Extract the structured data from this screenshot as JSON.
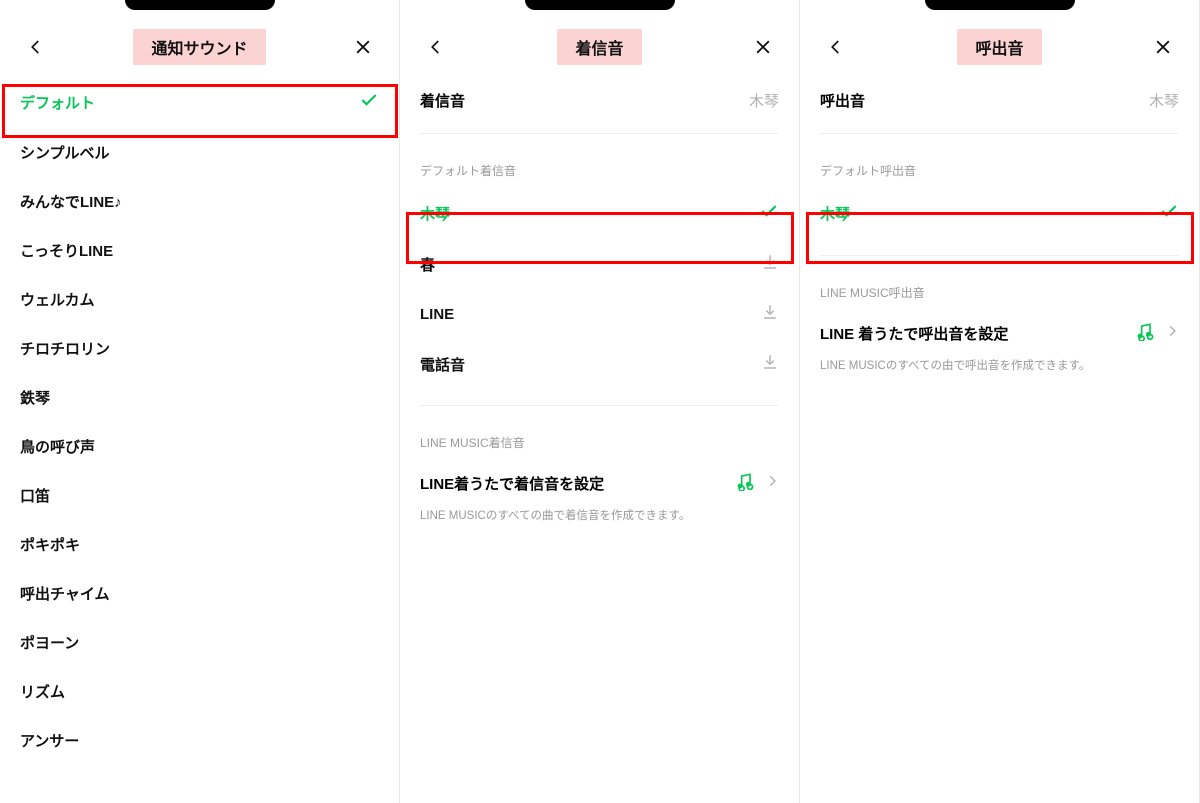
{
  "panes": {
    "left": {
      "title": "通知サウンド",
      "items": [
        {
          "label": "デフォルト",
          "selected": true
        },
        {
          "label": "シンプルベル"
        },
        {
          "label": "みんなでLINE♪"
        },
        {
          "label": "こっそりLINE"
        },
        {
          "label": "ウェルカム"
        },
        {
          "label": "チロチロリン"
        },
        {
          "label": "鉄琴"
        },
        {
          "label": "鳥の呼び声"
        },
        {
          "label": "口笛"
        },
        {
          "label": "ポキポキ"
        },
        {
          "label": "呼出チャイム"
        },
        {
          "label": "ポヨーン"
        },
        {
          "label": "リズム"
        },
        {
          "label": "アンサー"
        }
      ]
    },
    "middle": {
      "title": "着信音",
      "summary": {
        "label": "着信音",
        "value": "木琴"
      },
      "default_section": "デフォルト着信音",
      "items": [
        {
          "label": "木琴",
          "selected": true
        },
        {
          "label": "春",
          "download": true
        },
        {
          "label": "LINE",
          "download": true
        },
        {
          "label": "電話音",
          "download": true
        }
      ],
      "music_section": "LINE MUSIC着信音",
      "music_title": "LINE着うたで着信音を設定",
      "music_desc": "LINE MUSICのすべての曲で着信音を作成できます。"
    },
    "right": {
      "title": "呼出音",
      "summary": {
        "label": "呼出音",
        "value": "木琴"
      },
      "default_section": "デフォルト呼出音",
      "items": [
        {
          "label": "木琴",
          "selected": true
        }
      ],
      "music_section": "LINE MUSIC呼出音",
      "music_title": "LINE 着うたで呼出音を設定",
      "music_desc": "LINE MUSICのすべての由で呼出音を作成できます。"
    }
  }
}
